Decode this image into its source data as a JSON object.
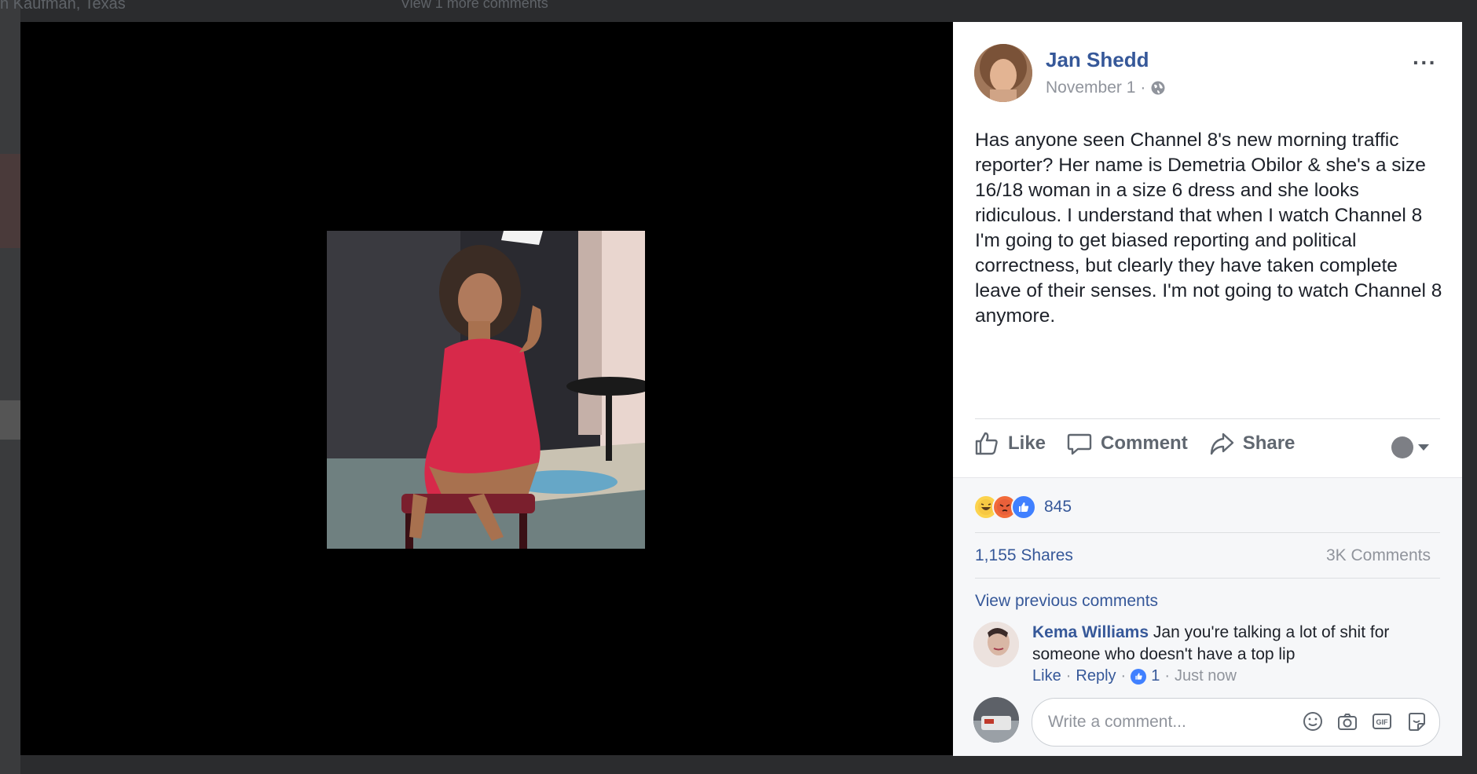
{
  "background": {
    "location_text": "n Kaufman, Texas",
    "more_comments_text": "View 1 more comments"
  },
  "post": {
    "author": "Jan Shedd",
    "date": "November 1",
    "separator": "·",
    "privacy_icon": "globe-icon",
    "text": "Has anyone seen Channel 8's new morning traffic reporter? Her name is Demetria Obilor & she's a size 16/18 woman in a size 6 dress and she looks ridiculous. I understand that when I watch Channel 8 I'm going to get biased reporting and political correctness, but clearly they have taken complete leave of their senses. I'm not going to watch Channel 8 anymore.",
    "options_label": "···"
  },
  "actions": {
    "like_label": "Like",
    "comment_label": "Comment",
    "share_label": "Share"
  },
  "stats": {
    "reaction_icons": [
      "haha",
      "angry",
      "like"
    ],
    "reaction_count": "845",
    "shares": "1,155 Shares",
    "comments": "3K Comments"
  },
  "comments": {
    "view_previous": "View previous comments",
    "items": [
      {
        "name": "Kema Williams",
        "text": "Jan you're talking a lot of shit for someone who doesn't have a top lip",
        "like_label": "Like",
        "reply_label": "Reply",
        "likes": "1",
        "time": "Just now"
      }
    ]
  },
  "composer": {
    "placeholder": "Write a comment...",
    "tools": [
      "emoji-icon",
      "camera-icon",
      "gif-icon",
      "sticker-icon"
    ]
  },
  "colors": {
    "link": "#365899",
    "viewer_bg": "#000000",
    "panel_bg": "#ffffff"
  }
}
